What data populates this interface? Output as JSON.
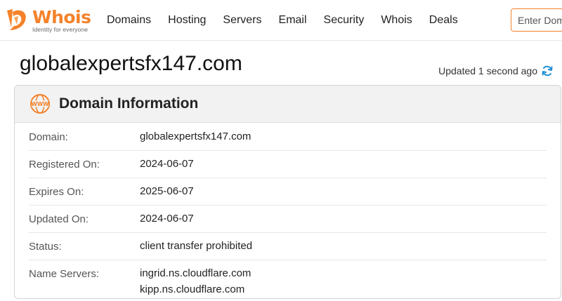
{
  "header": {
    "logo": {
      "word": "Whois",
      "tagline": "Identity for everyone"
    },
    "nav": [
      "Domains",
      "Hosting",
      "Servers",
      "Email",
      "Security",
      "Whois",
      "Deals"
    ],
    "search": {
      "placeholder": "Enter Domain"
    }
  },
  "page": {
    "domain": "globalexpertsfx147.com",
    "updated": "Updated 1 second ago"
  },
  "panel": {
    "title": "Domain Information",
    "icon_label": "WWW",
    "rows": [
      {
        "label": "Domain:",
        "value": "globalexpertsfx147.com"
      },
      {
        "label": "Registered On:",
        "value": "2024-06-07"
      },
      {
        "label": "Expires On:",
        "value": "2025-06-07"
      },
      {
        "label": "Updated On:",
        "value": "2024-06-07"
      },
      {
        "label": "Status:",
        "value": "client transfer prohibited"
      },
      {
        "label": "Name Servers:",
        "values": [
          "ingrid.ns.cloudflare.com",
          "kipp.ns.cloudflare.com"
        ]
      }
    ]
  },
  "colors": {
    "brand": "#f5822a",
    "refresh": "#1f8fd6",
    "panel_header": "#f2f2f2"
  }
}
